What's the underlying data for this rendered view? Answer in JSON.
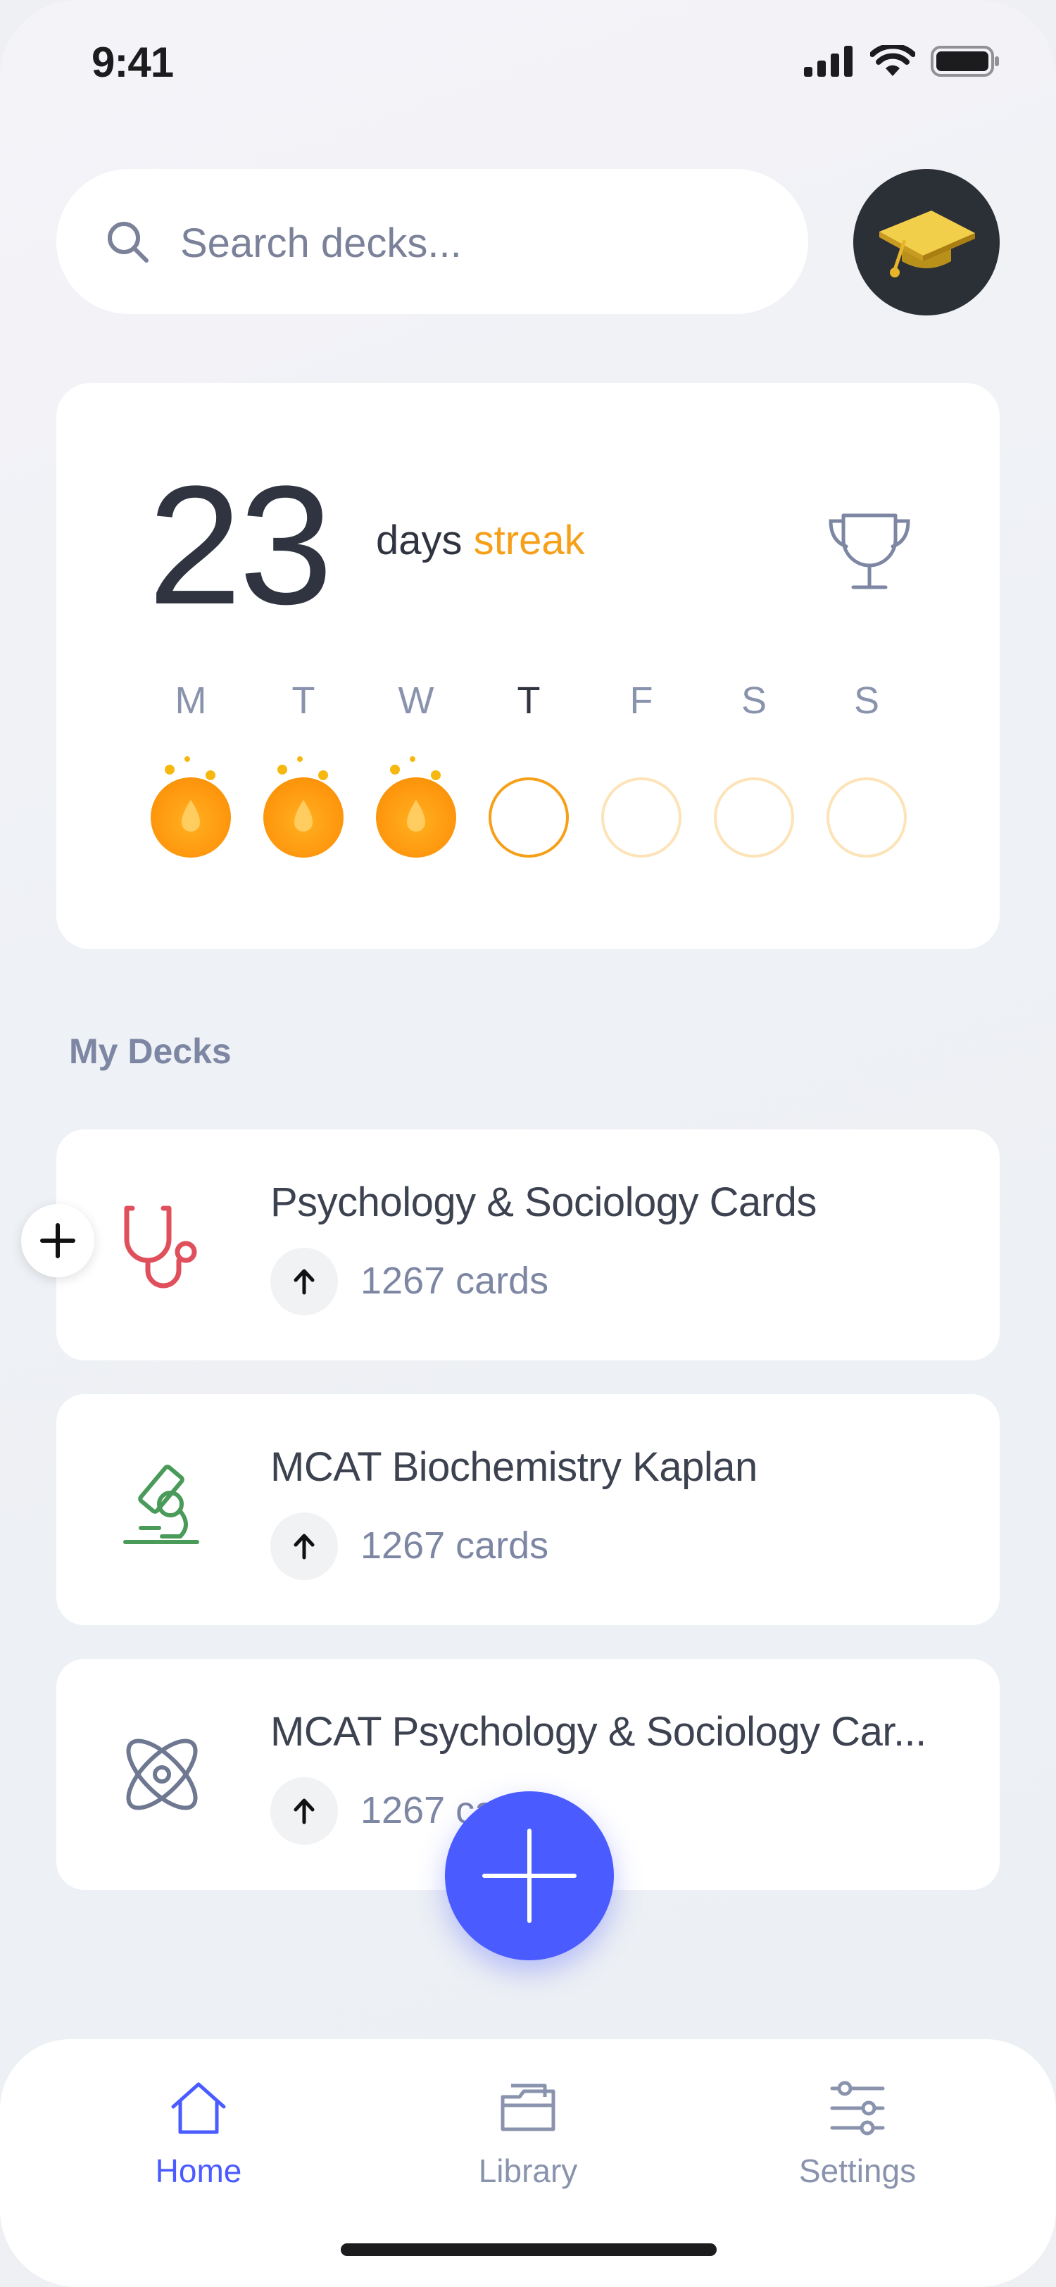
{
  "status_bar": {
    "time": "9:41"
  },
  "search": {
    "placeholder": "Search decks..."
  },
  "streak": {
    "count": "23",
    "days_label": "days",
    "streak_label": "streak",
    "week": [
      {
        "letter": "M",
        "state": "done"
      },
      {
        "letter": "T",
        "state": "done"
      },
      {
        "letter": "W",
        "state": "done"
      },
      {
        "letter": "T",
        "state": "today"
      },
      {
        "letter": "F",
        "state": "future"
      },
      {
        "letter": "S",
        "state": "future"
      },
      {
        "letter": "S",
        "state": "future"
      }
    ]
  },
  "section": {
    "title": "My Decks"
  },
  "decks": [
    {
      "title": "Psychology & Sociology Cards",
      "count": "1267 cards",
      "icon": "stethoscope-icon"
    },
    {
      "title": "MCAT Biochemistry Kaplan",
      "count": "1267 cards",
      "icon": "microscope-icon"
    },
    {
      "title": "MCAT Psychology & Sociology Car...",
      "count": "1267 cards",
      "icon": "atom-icon"
    }
  ],
  "tabs": [
    {
      "label": "Home",
      "icon": "home-icon",
      "active": true
    },
    {
      "label": "Library",
      "icon": "folder-icon",
      "active": false
    },
    {
      "label": "Settings",
      "icon": "sliders-icon",
      "active": false
    }
  ],
  "colors": {
    "accent": "#4a5bff",
    "streak": "#f6a019",
    "text": "#2f3440",
    "muted": "#7d86a3"
  }
}
